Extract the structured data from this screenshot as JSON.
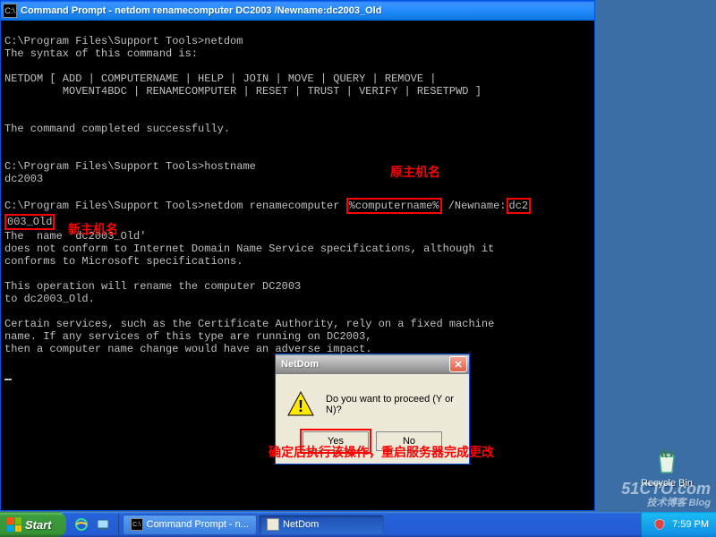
{
  "cmd": {
    "title": "Command Prompt - netdom renamecomputer DC2003 /Newname:dc2003_Old",
    "lines": {
      "l1": "C:\\Program Files\\Support Tools>netdom",
      "l2": "The syntax of this command is:",
      "l3": "NETDOM [ ADD | COMPUTERNAME | HELP | JOIN | MOVE | QUERY | REMOVE |",
      "l4": "         MOVENT4BDC | RENAMECOMPUTER | RESET | TRUST | VERIFY | RESETPWD ]",
      "l5": "The command completed successfully.",
      "l6": "C:\\Program Files\\Support Tools>hostname",
      "l7": "dc2003",
      "l8a": "C:\\Program Files\\Support Tools>netdom renamecomputer ",
      "l8b": "%computername%",
      "l8c": " /Newname:",
      "l8d": "dc2",
      "l9a": "003_Old",
      "l10": "The  name 'dc2003_Old'",
      "l11": "does not conform to Internet Domain Name Service specifications, although it",
      "l12": "conforms to Microsoft specifications.",
      "l13": "This operation will rename the computer DC2003",
      "l14": "to dc2003_Old.",
      "l15": "Certain services, such as the Certificate Authority, rely on a fixed machine",
      "l16": "name. If any services of this type are running on DC2003,",
      "l17": "then a computer name change would have an adverse impact."
    }
  },
  "annotations": {
    "orig_host": "原主机名",
    "new_host": "新主机名",
    "confirm": "确定后执行该操作，重启服务器完成更改"
  },
  "dialog": {
    "title": "NetDom",
    "message": "Do you want to proceed (Y or N)?",
    "yes": "Yes",
    "no": "No"
  },
  "desktop": {
    "recycle": "Recycle Bin"
  },
  "watermark": {
    "main": "51CTO.com",
    "sub": "技术博客  Blog"
  },
  "taskbar": {
    "start": "Start",
    "task1": "Command Prompt - n...",
    "task2": "NetDom",
    "clock": "7:59 PM"
  }
}
